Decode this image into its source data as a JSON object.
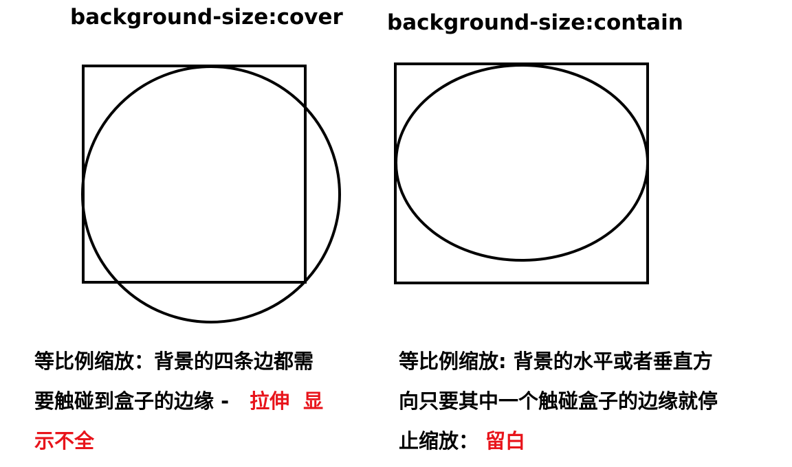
{
  "cover": {
    "title": "background-size:cover",
    "desc_line1": "等比例缩放：背景的四条边都需",
    "desc_line2": "要触碰到盒子的边缘 -",
    "desc_highlight_a": "拉伸",
    "desc_highlight_b": "显",
    "desc_line3": "示不全"
  },
  "contain": {
    "title": "background-size:contain",
    "desc_line1": "等比例缩放: 背景的水平或者垂直方",
    "desc_line2": "向只要其中一个触碰盒子的边缘就停",
    "desc_line3": "止缩放：",
    "desc_highlight": "留白"
  },
  "colors": {
    "text": "#000000",
    "highlight": "#e8141b",
    "stroke": "#000000",
    "background": "#ffffff"
  }
}
